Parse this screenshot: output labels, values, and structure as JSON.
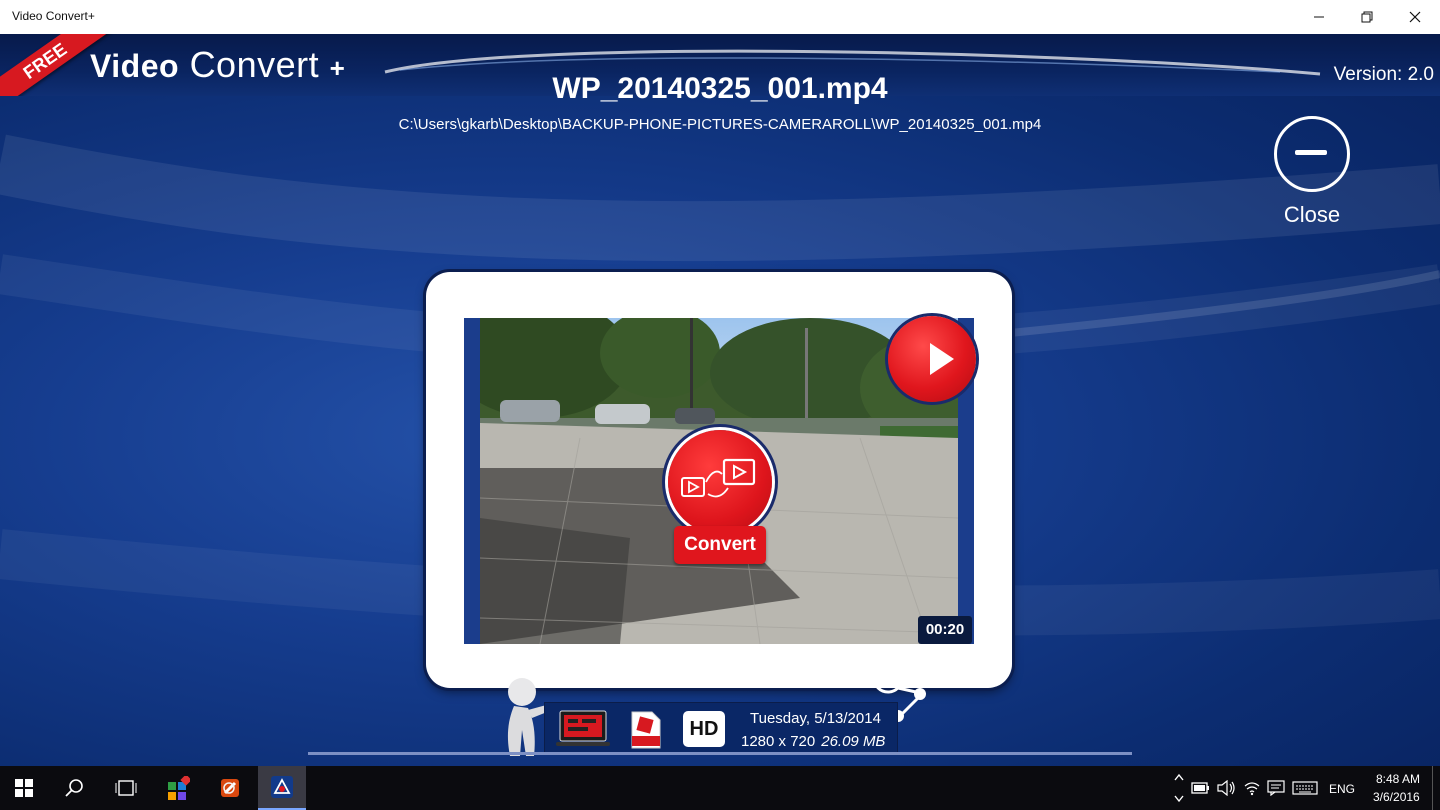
{
  "window": {
    "title": "Video Convert+",
    "controls": [
      "minimize",
      "restore",
      "close"
    ]
  },
  "header": {
    "badge": "FREE",
    "logo_text_bold": "Video",
    "logo_text": "Convert",
    "logo_plus": "+",
    "version": "Version: 2.0"
  },
  "file": {
    "name": "WP_20140325_001.mp4",
    "path": "C:\\Users\\gkarb\\Desktop\\BACKUP-PHONE-PICTURES-CAMERAROLL\\WP_20140325_001.mp4"
  },
  "close_button": {
    "label": "Close"
  },
  "video": {
    "convert_label": "Convert",
    "duration": "00:20"
  },
  "info": {
    "quality_badge": "HD",
    "date": "Tuesday, 5/13/2014",
    "resolution": "1280 x 720",
    "size": "26.09 MB"
  },
  "taskbar": {
    "language": "ENG",
    "time": "8:48 AM",
    "date": "3/6/2016"
  },
  "colors": {
    "accent_red": "#e0161d",
    "background_blue": "#0c2d72",
    "header_dark": "#071a4b"
  }
}
